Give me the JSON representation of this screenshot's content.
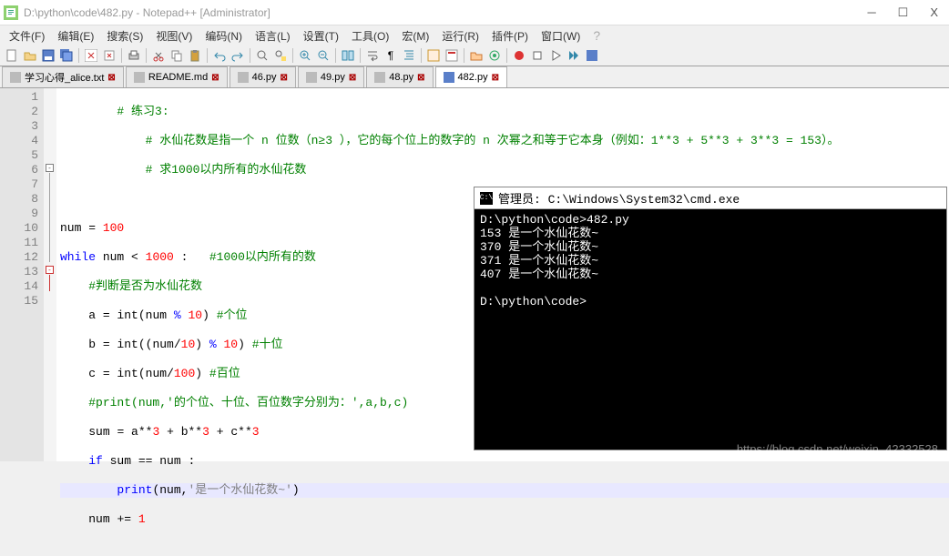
{
  "window": {
    "title": "D:\\python\\code\\482.py - Notepad++ [Administrator]",
    "close_x": "X"
  },
  "menu": {
    "file": "文件(F)",
    "edit": "编辑(E)",
    "search": "搜索(S)",
    "view": "视图(V)",
    "encoding": "编码(N)",
    "language": "语言(L)",
    "settings": "设置(T)",
    "tools": "工具(O)",
    "macro": "宏(M)",
    "run": "运行(R)",
    "plugins": "插件(P)",
    "window": "窗口(W)",
    "help": "?"
  },
  "tabs": [
    {
      "label": "学习心得_alice.txt"
    },
    {
      "label": "README.md"
    },
    {
      "label": "46.py"
    },
    {
      "label": "49.py"
    },
    {
      "label": "48.py"
    },
    {
      "label": "482.py"
    }
  ],
  "code": {
    "lines": {
      "1": "# 练习3:",
      "2": "# 水仙花数是指一个 n 位数（n≥3 ），它的每个位上的数字的 n 次幂之和等于它本身（例如：1**3 + 5**3 + 3**3 = 153）。",
      "3": "# 求1000以内所有的水仙花数",
      "5_a": "num ",
      "5_eq": "=",
      "5_b": " 100",
      "6_a": "while",
      "6_b": " num ",
      "6_c": "<",
      "6_d": " 1000 ",
      "6_e": ":",
      "6_f": "   #1000以内所有的数",
      "7": "#判断是否为水仙花数",
      "8_a": "a ",
      "8_b": "= int",
      "8_c": "(",
      "8_d": "num ",
      "8_e": "%",
      "8_f": " 10",
      "8_g": ")",
      "8_h": " #个位",
      "9_a": "b ",
      "9_b": "= int",
      "9_c": "((",
      "9_d": "num",
      "9_e": "/",
      "9_f": "10",
      "9_g": ")",
      "9_h": " %",
      "9_i": " 10",
      "9_j": ")",
      "9_k": " #十位",
      "10_a": "c ",
      "10_b": "= int",
      "10_c": "(",
      "10_d": "num",
      "10_e": "/",
      "10_f": "100",
      "10_g": ")",
      "10_h": " #百位",
      "11_a": "#print(num,'的个位、十位、百位数字分别为：',a,b,c)",
      "12_a": "sum ",
      "12_b": "=",
      "12_c": " a",
      "12_d": "**",
      "12_e": "3",
      "12_f": " +",
      "12_g": " b",
      "12_h": "**",
      "12_i": "3",
      "12_j": " +",
      "12_k": " c",
      "12_l": "**",
      "12_m": "3",
      "13_a": "if",
      "13_b": " sum ",
      "13_c": "==",
      "13_d": " num ",
      "13_e": ":",
      "14_a": "print",
      "14_b": "(",
      "14_c": "num",
      "14_d": ",",
      "14_e": "'是一个水仙花数~'",
      "14_f": ")",
      "15_a": "num ",
      "15_b": "+=",
      "15_c": " 1"
    },
    "line_numbers": [
      "1",
      "2",
      "3",
      "4",
      "5",
      "6",
      "7",
      "8",
      "9",
      "10",
      "11",
      "12",
      "13",
      "14",
      "15"
    ]
  },
  "terminal": {
    "title": "管理员: C:\\Windows\\System32\\cmd.exe",
    "output": "D:\\python\\code>482.py\n153 是一个水仙花数~\n370 是一个水仙花数~\n371 是一个水仙花数~\n407 是一个水仙花数~\n\nD:\\python\\code>"
  },
  "watermark": "https://blog.csdn.net/weixin_42332528"
}
